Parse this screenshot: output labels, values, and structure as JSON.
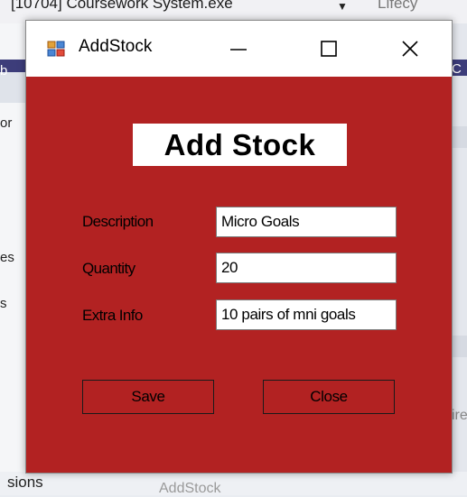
{
  "background": {
    "process_title": "[10704] Coursework System.exe",
    "lifecycle_label": "Lifecy",
    "left_labels": [
      "b",
      "or",
      "es",
      "s"
    ],
    "right_labels": [
      "C",
      "ire"
    ],
    "bottom_left": "sions",
    "bottom_tab": "AddStock"
  },
  "window": {
    "title": "AddStock",
    "icon": "winforms-app-icon",
    "controls": {
      "minimize_icon": "minimize-icon",
      "maximize_icon": "maximize-icon",
      "close_icon": "close-icon"
    },
    "background_color": "#b22222"
  },
  "form": {
    "heading": "Add Stock",
    "fields": {
      "description": {
        "label": "Description",
        "value": "Micro Goals"
      },
      "quantity": {
        "label": "Quantity",
        "value": "20"
      },
      "extra_info": {
        "label": "Extra Info",
        "value": "10 pairs of mni goals"
      }
    },
    "buttons": {
      "save": "Save",
      "close": "Close"
    }
  }
}
